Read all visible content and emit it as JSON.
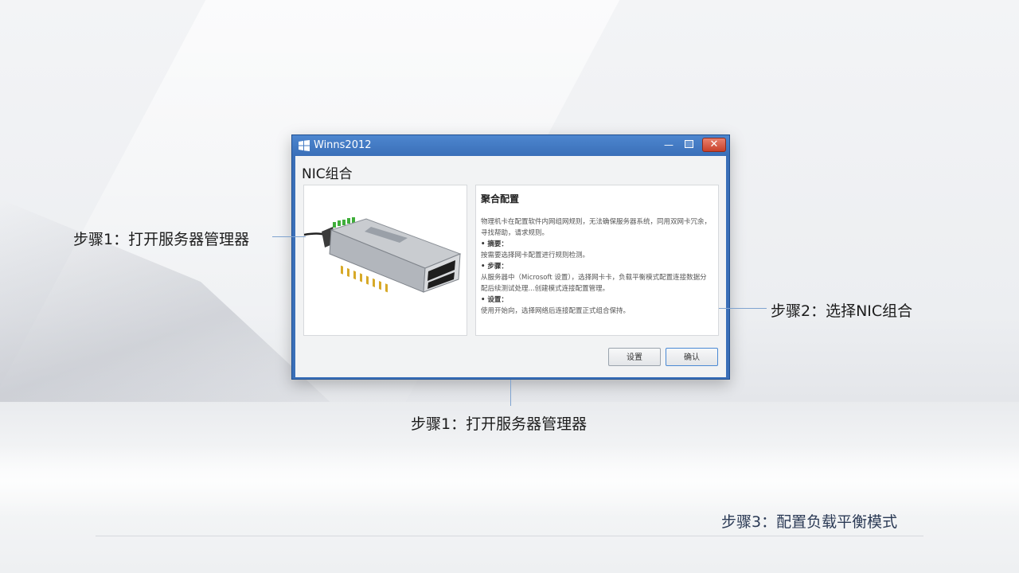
{
  "window": {
    "title": "Winns2012",
    "dialog_title": "NIC组合",
    "minimize_glyph": "—",
    "close_glyph": "✕"
  },
  "info_panel": {
    "heading": "聚合配置",
    "paragraph": "物理机卡在配置软件内网组网规则，无法确保服务器系统，同用双网卡冗余，寻找帮助，请求规则。",
    "sections": [
      {
        "bullet": "• 摘要：",
        "text": "按需要选择网卡配置进行规则检测。"
      },
      {
        "bullet": "• 步骤：",
        "text": "从服务器中（Microsoft 设置），选择网卡卡，负载平衡模式配置连接数据分配后续测试处理...创建模式连接配置管理。"
      },
      {
        "bullet": "• 设置：",
        "text": "使用开始向，选择网络后连接配置正式组合保持。"
      }
    ]
  },
  "buttons": {
    "secondary": "设置",
    "primary": "确认"
  },
  "annotations": {
    "left": "步骤1：打开服务器管理器",
    "right": "步骤2：选择NIC组合",
    "bottom": "步骤1：打开服务器管理器",
    "step3": "步骤3：配置负载平衡模式"
  },
  "icons": {
    "window_logo": "windows-logo-icon",
    "product_image": "sfp-transceiver-image"
  },
  "colors": {
    "titlebar": "#3a6fb8",
    "close_button": "#c8402a",
    "connector_line": "#7fa3cf",
    "step3_text": "#2b3a55"
  }
}
